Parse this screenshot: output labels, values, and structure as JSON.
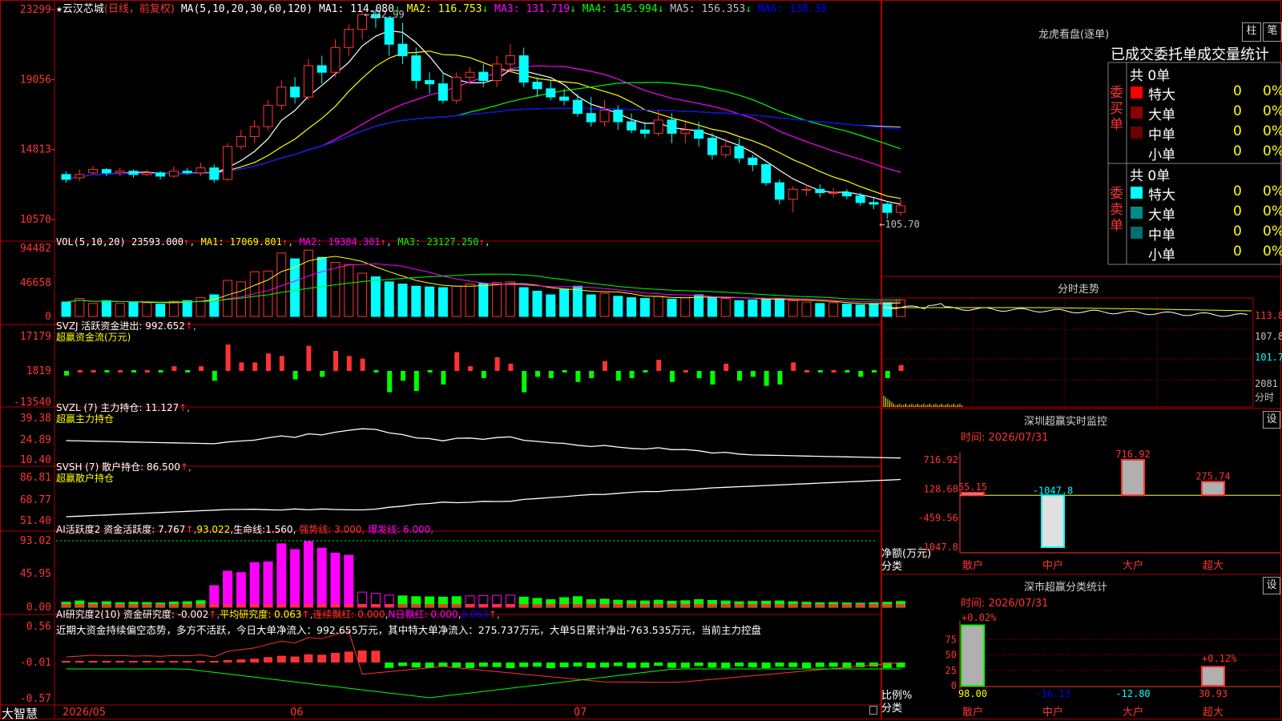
{
  "header": {
    "star": "★",
    "stock_name": "云汉芯城",
    "mode": "(日线，前复权)",
    "ma_label": "MA(5,10,20,30,60,120)",
    "ma_values": [
      {
        "name": "MA1:",
        "value": "114.080",
        "arrow": "↓",
        "color": "#ffffff"
      },
      {
        "name": "MA2:",
        "value": "116.753",
        "arrow": "↓",
        "color": "#ffff00"
      },
      {
        "name": "MA3:",
        "value": "131.719",
        "arrow": "↓",
        "color": "#ff00ff"
      },
      {
        "name": "MA4:",
        "value": "145.994",
        "arrow": "↓",
        "color": "#00ff00"
      },
      {
        "name": "MA5:",
        "value": "156.353",
        "arrow": "↓",
        "color": "#c0c0c0"
      },
      {
        "name": "MA6:",
        "value": "138.33",
        "arrow": "",
        "color": "#0000ff"
      }
    ]
  },
  "panels": {
    "price": {
      "yticks": [
        "23299",
        "19056",
        "14813",
        "10570"
      ],
      "high_label": "←232.99",
      "low_label": "←105.70"
    },
    "vol": {
      "label": "VOL(5,10,20)",
      "value": "23593.000",
      "ma": [
        {
          "name": "MA1:",
          "value": "17069.801",
          "color": "#ffff00"
        },
        {
          "name": "MA2:",
          "value": "19384.301",
          "color": "#ff00ff"
        },
        {
          "name": "MA3:",
          "value": "23127.250",
          "color": "#00ff00"
        }
      ],
      "yticks": [
        "94482",
        "46658",
        "0"
      ]
    },
    "svzj": {
      "label": "SVZJ  活跃资金进出:",
      "value": "992.652",
      "sub": "超赢资金流(万元)",
      "yticks": [
        "17179",
        "1819",
        "-13540"
      ]
    },
    "svzl": {
      "label": "SVZL (7) 主力持仓:",
      "value": "11.127",
      "sub": "超赢主力持仓",
      "yticks": [
        "39.38",
        "24.89",
        "10.40"
      ]
    },
    "svsh": {
      "label": "SVSH (7) 散户持仓:",
      "value": "86.500",
      "sub": "超赢散户持仓",
      "yticks": [
        "86.81",
        "68.77",
        "51.40"
      ]
    },
    "ai1": {
      "label": "AI活跃度2 资金活跃度:",
      "value": "7.767",
      "v2": "93.022",
      "life_label": "生命线:",
      "life": "1.560",
      "strong": "强势线: 3.000,",
      "burst": "爆发线: 6.000,",
      "yticks": [
        "93.02",
        "45.95",
        "0.00"
      ]
    },
    "ai2": {
      "label": "AI研究度2(10) 资金研究度:",
      "value": "-0.002",
      "avg_label": "平均研究度:",
      "avg": "0.063",
      "lian_label": "连续飘红:",
      "lian": "0.000",
      "n_label": "N日飘红:",
      "n": "0.000",
      "last": "0.063",
      "comment": "近期大资金持续偏空态势，多方不活跃，今日大单净流入：992.655万元，其中特大单净流入：275.737万元，大单5日累计净出-763.535万元，当前主力控盘",
      "yticks": [
        "0.56",
        "-0.01",
        "-0.57"
      ]
    }
  },
  "bottom": {
    "brand": "大智慧",
    "dates": [
      "2026/05",
      "06",
      "07"
    ]
  },
  "right": {
    "lhb_title": "龙虎看盘(逐单)",
    "btn_zhu": "柱",
    "btn_bi": "笔",
    "table_title": "已成交委托单成交量统计",
    "buy_side": "委买单",
    "sell_side": "委卖单",
    "buy_total": "共 0单",
    "sell_total": "共 0单",
    "buy_rows": [
      {
        "label": "特大",
        "count": "0",
        "pct": "0%",
        "color": "#ff0000"
      },
      {
        "label": "大单",
        "count": "0",
        "pct": "0%",
        "color": "#8b0000"
      },
      {
        "label": "中单",
        "count": "0",
        "pct": "0%",
        "color": "#6b0000"
      },
      {
        "label": "小单",
        "count": "0",
        "pct": "0%",
        "color": ""
      }
    ],
    "sell_rows": [
      {
        "label": "特大",
        "count": "0",
        "pct": "0%",
        "color": "#00ffff"
      },
      {
        "label": "大单",
        "count": "0",
        "pct": "0%",
        "color": "#008b8b"
      },
      {
        "label": "中单",
        "count": "0",
        "pct": "0%",
        "color": "#007070"
      },
      {
        "label": "小单",
        "count": "0",
        "pct": "0%",
        "color": ""
      }
    ],
    "intraday_title": "分时走势",
    "intraday_ticks": [
      "113.8",
      "107.8",
      "101.7",
      "2081",
      "分时"
    ],
    "monitor_title": "深圳超赢实时监控",
    "monitor_time": "时间: 2026/07/31",
    "monitor_btn": "设",
    "monitor_yticks": [
      "716.92",
      "128.68",
      "-459.56",
      "-1047.8"
    ],
    "monitor_ylabel": "净额(万元)",
    "monitor_xlabel": "分类",
    "monitor_cats": [
      "散户",
      "中户",
      "大户",
      "超大"
    ],
    "monitor_values": [
      "55.15",
      "-1047.8",
      "716.92",
      "275.74"
    ],
    "stats_title": "深市超赢分类统计",
    "stats_time": "时间: 2026/07/31",
    "stats_btn": "设",
    "stats_yticks": [
      "75",
      "50",
      "25",
      "0"
    ],
    "stats_ylabel": "比例%",
    "stats_xlabel": "分类",
    "stats_cats": [
      "散户",
      "中户",
      "大户",
      "超大"
    ],
    "stats_values": [
      "98.00",
      "-16.13",
      "-12.80",
      "30.93"
    ],
    "stats_tags": [
      "+0.02%",
      "+0.12%"
    ]
  },
  "chart_data": {
    "type": "candlestick",
    "title": "云汉芯城 (日线，前复权)",
    "ylim": [
      105.7,
      232.99
    ],
    "candles": [
      [
        133,
        130,
        135,
        128
      ],
      [
        131,
        133,
        136,
        129
      ],
      [
        134,
        136,
        138,
        133
      ],
      [
        136,
        134,
        137,
        132
      ],
      [
        134,
        135,
        137,
        132
      ],
      [
        135,
        133,
        136,
        131
      ],
      [
        133,
        134,
        136,
        132
      ],
      [
        134,
        132,
        135,
        130
      ],
      [
        132,
        135,
        138,
        131
      ],
      [
        135,
        134,
        137,
        133
      ],
      [
        134,
        137,
        140,
        132
      ],
      [
        137,
        130,
        139,
        128
      ],
      [
        130,
        150,
        152,
        129
      ],
      [
        150,
        156,
        160,
        148
      ],
      [
        156,
        162,
        166,
        152
      ],
      [
        162,
        175,
        178,
        160
      ],
      [
        175,
        186,
        190,
        172
      ],
      [
        186,
        180,
        192,
        176
      ],
      [
        180,
        199,
        203,
        178
      ],
      [
        199,
        195,
        205,
        188
      ],
      [
        195,
        210,
        215,
        192
      ],
      [
        210,
        221,
        224,
        205
      ],
      [
        221,
        230,
        233,
        215
      ],
      [
        230,
        228,
        233,
        222
      ],
      [
        228,
        212,
        220,
        205
      ],
      [
        212,
        205,
        225,
        200
      ],
      [
        205,
        190,
        210,
        185
      ],
      [
        190,
        188,
        195,
        182
      ],
      [
        188,
        178,
        195,
        176
      ],
      [
        178,
        192,
        195,
        176
      ],
      [
        192,
        195,
        198,
        188
      ],
      [
        195,
        190,
        200,
        186
      ],
      [
        190,
        200,
        205,
        186
      ],
      [
        200,
        205,
        212,
        195
      ],
      [
        205,
        189,
        210,
        186
      ],
      [
        189,
        185,
        192,
        180
      ],
      [
        185,
        180,
        190,
        178
      ],
      [
        180,
        178,
        185,
        175
      ],
      [
        178,
        170,
        182,
        168
      ],
      [
        170,
        165,
        180,
        162
      ],
      [
        165,
        172,
        178,
        162
      ],
      [
        172,
        165,
        175,
        160
      ],
      [
        165,
        160,
        170,
        158
      ],
      [
        160,
        158,
        165,
        155
      ],
      [
        158,
        166,
        172,
        156
      ],
      [
        166,
        158,
        170,
        152
      ],
      [
        158,
        160,
        165,
        152
      ],
      [
        160,
        155,
        165,
        150
      ],
      [
        155,
        145,
        158,
        142
      ],
      [
        145,
        150,
        155,
        143
      ],
      [
        150,
        143,
        155,
        140
      ],
      [
        143,
        139,
        145,
        135
      ],
      [
        139,
        128,
        140,
        126
      ],
      [
        128,
        118,
        130,
        115
      ],
      [
        118,
        124,
        126,
        110
      ],
      [
        124,
        124,
        127,
        120
      ],
      [
        124,
        122,
        127,
        119
      ],
      [
        122,
        122,
        125,
        119
      ],
      [
        122,
        120,
        124,
        118
      ],
      [
        120,
        116,
        122,
        114
      ],
      [
        116,
        115,
        119,
        112
      ],
      [
        115,
        110,
        116,
        106
      ],
      [
        110,
        114,
        118,
        108
      ]
    ],
    "volume": [
      20,
      25,
      18,
      22,
      18,
      20,
      19,
      17,
      21,
      22,
      26,
      30,
      50,
      48,
      62,
      63,
      88,
      80,
      92,
      82,
      75,
      72,
      60,
      55,
      48,
      45,
      42,
      41,
      40,
      42,
      45,
      46,
      47,
      48,
      40,
      35,
      30,
      38,
      42,
      30,
      32,
      28,
      26,
      25,
      28,
      24,
      26,
      30,
      27,
      25,
      22,
      23,
      24,
      25,
      22,
      20,
      18,
      19,
      17,
      16,
      18,
      20,
      23
    ]
  }
}
